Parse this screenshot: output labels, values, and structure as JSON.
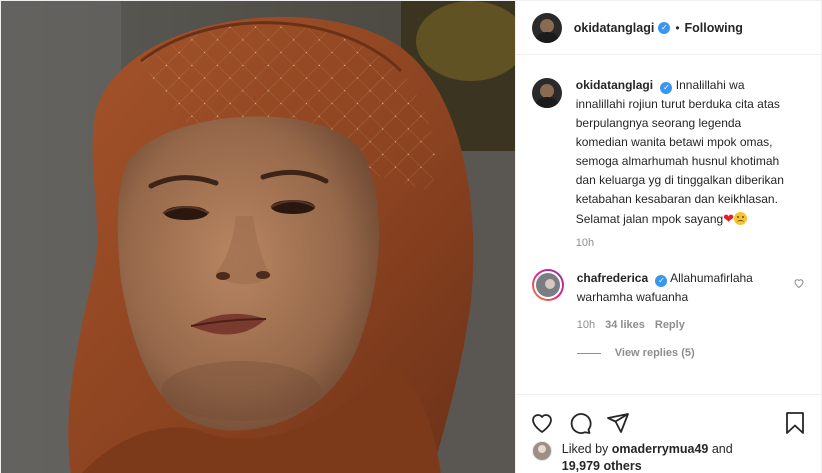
{
  "header": {
    "username": "okidatanglagi",
    "separator": "•",
    "follow_state": "Following"
  },
  "caption": {
    "username": "okidatanglagi",
    "text": "Innalillahi wa innalillahi rojiun turut berduka cita atas berpulangnya seorang legenda komedian wanita betawi mpok omas, semoga almarhumah husnul khotimah dan keluarga yg di tinggalkan diberikan ketabahan kesabaran dan keikhlasan. Selamat jalan mpok sayang",
    "emoji_heart": "❤",
    "time": "10h"
  },
  "comment": {
    "username": "chafrederica",
    "text": "Allahumafirlaha warhamha wafuanha",
    "time": "10h",
    "likes": "34 likes",
    "reply": "Reply"
  },
  "view_replies": "View replies (5)",
  "liked_by": {
    "prefix": "Liked by",
    "user": "omaderrymua49",
    "conjunction": "and",
    "count": "19,979 others"
  },
  "icons": [
    "heart-icon",
    "comment-icon",
    "share-icon",
    "bookmark-icon",
    "verified-icon"
  ],
  "colors": {
    "verified": "#3897f0",
    "muted": "#8e8e8e",
    "text": "#262626"
  }
}
